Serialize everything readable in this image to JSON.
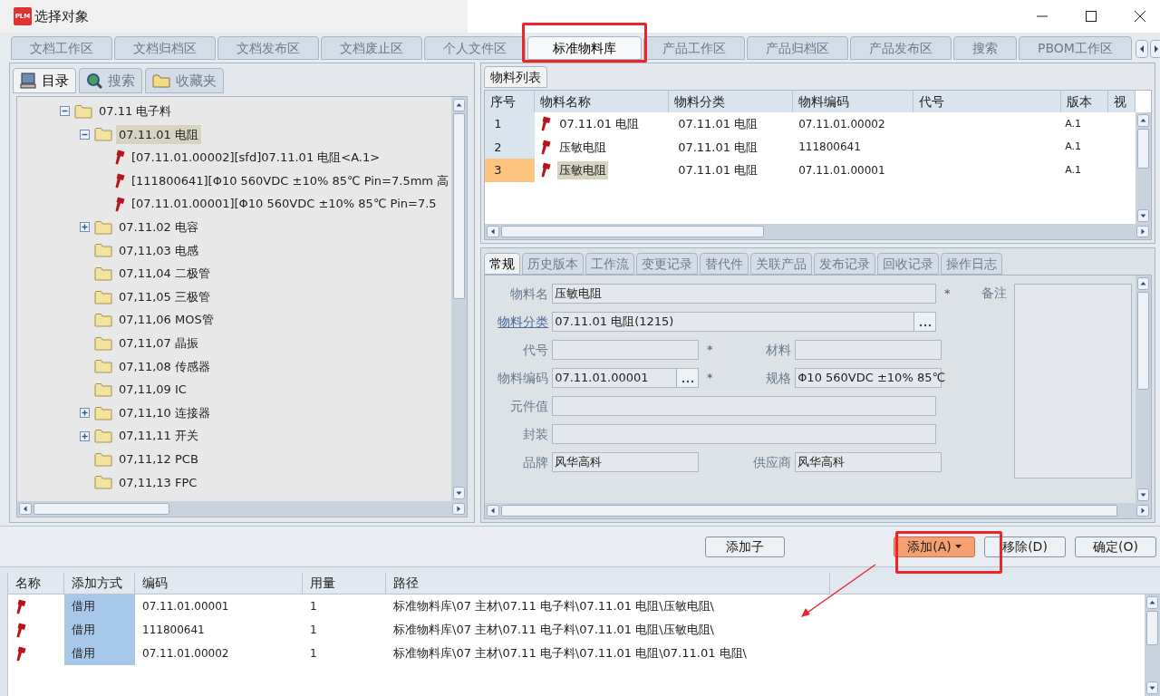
{
  "window": {
    "logo": "PLM",
    "title": "选择对象"
  },
  "tabs": [
    {
      "label": "文档工作区",
      "selected": false
    },
    {
      "label": "文档归档区",
      "selected": false
    },
    {
      "label": "文档发布区",
      "selected": false
    },
    {
      "label": "文档废止区",
      "selected": false
    },
    {
      "label": "个人文件区",
      "selected": false
    },
    {
      "label": "标准物料库",
      "selected": true
    },
    {
      "label": "产品工作区",
      "selected": false
    },
    {
      "label": "产品归档区",
      "selected": false
    },
    {
      "label": "产品发布区",
      "selected": false
    },
    {
      "label": "搜索",
      "selected": false
    },
    {
      "label": "PBOM工作区",
      "selected": false
    }
  ],
  "left_tabs": [
    {
      "label": "目录",
      "selected": true
    },
    {
      "label": "搜索",
      "selected": false
    },
    {
      "label": "收藏夹",
      "selected": false
    }
  ],
  "tree": [
    {
      "label": "07.11 电子料",
      "kind": "folder",
      "expanded": true,
      "selected": false,
      "children": [
        {
          "label": "07.11.01 电阻",
          "kind": "folder",
          "expanded": true,
          "selected": true,
          "children": [
            {
              "label": "[07.11.01.00002][sfd]07.11.01 电阻<A.1>",
              "kind": "part",
              "selected": false
            },
            {
              "label": "[111800641][Φ10 560VDC ±10% 85℃ Pin=7.5mm 高",
              "kind": "part",
              "selected": false
            },
            {
              "label": "[07.11.01.00001][Φ10 560VDC ±10% 85℃ Pin=7.5",
              "kind": "part",
              "selected": false
            }
          ]
        },
        {
          "label": "07.11.02 电容",
          "kind": "folder",
          "expanded": false,
          "selected": false
        },
        {
          "label": "07,11,03 电感",
          "kind": "folder",
          "selected": false
        },
        {
          "label": "07,11,04 二极管",
          "kind": "folder",
          "selected": false
        },
        {
          "label": "07,11,05 三极管",
          "kind": "folder",
          "selected": false
        },
        {
          "label": "07,11,06 MOS管",
          "kind": "folder",
          "selected": false
        },
        {
          "label": "07,11,07 晶振",
          "kind": "folder",
          "selected": false
        },
        {
          "label": "07,11,08 传感器",
          "kind": "folder",
          "selected": false
        },
        {
          "label": "07,11,09 IC",
          "kind": "folder",
          "selected": false
        },
        {
          "label": "07,11,10 连接器",
          "kind": "folder",
          "expanded": false,
          "selected": false
        },
        {
          "label": "07,11,11 开关",
          "kind": "folder",
          "expanded": false,
          "selected": false
        },
        {
          "label": "07,11,12 PCB",
          "kind": "folder",
          "selected": false
        },
        {
          "label": "07,11,13 FPC",
          "kind": "folder",
          "selected": false
        }
      ]
    }
  ],
  "list_tab": "物料列表",
  "material_table": {
    "columns": [
      "序号",
      "物料名称",
      "物料分类",
      "物料编码",
      "代号",
      "版本",
      "视"
    ],
    "rows": [
      {
        "no": "1",
        "name": "07.11.01 电阻",
        "category": "07.11.01 电阻",
        "code": "07.11.01.00002",
        "version": "A.1",
        "selected": false
      },
      {
        "no": "2",
        "name": "压敏电阻",
        "category": "07.11.01 电阻",
        "code": "111800641",
        "version": "A.1",
        "selected": false
      },
      {
        "no": "3",
        "name": "压敏电阻",
        "category": "07.11.01 电阻",
        "code": "07.11.01.00001",
        "version": "A.1",
        "selected": true
      }
    ]
  },
  "detail_tabs": [
    {
      "label": "常规",
      "selected": true
    },
    {
      "label": "历史版本",
      "selected": false
    },
    {
      "label": "工作流",
      "selected": false
    },
    {
      "label": "变更记录",
      "selected": false
    },
    {
      "label": "替代件",
      "selected": false
    },
    {
      "label": "关联产品",
      "selected": false
    },
    {
      "label": "发布记录",
      "selected": false
    },
    {
      "label": "回收记录",
      "selected": false
    },
    {
      "label": "操作日志",
      "selected": false
    }
  ],
  "form": {
    "rows": [
      [
        {
          "label": "物料名",
          "value": "压敏电阻",
          "mark": "*",
          "link": false,
          "picker": false
        }
      ],
      [
        {
          "label": "物料分类",
          "value": "07.11.01 电阻(1215)",
          "link": true,
          "picker": true
        }
      ],
      [
        {
          "label": "代号",
          "mark": "*",
          "link": false,
          "picker": false
        },
        {
          "label": "材料",
          "link": false,
          "picker": false
        }
      ],
      [
        {
          "label": "物料编码",
          "value": "07.11.01.00001",
          "mark": "*",
          "link": false,
          "picker": true
        },
        {
          "label": "规格",
          "value": "Φ10 560VDC ±10% 85℃",
          "link": false,
          "picker": false
        }
      ],
      [
        {
          "label": "元件值",
          "link": false,
          "picker": false
        }
      ],
      [
        {
          "label": "封装",
          "link": false,
          "picker": false
        }
      ],
      [
        {
          "label": "品牌",
          "value": "风华高科",
          "link": false,
          "picker": false
        },
        {
          "label": "供应商",
          "value": "风华高科",
          "link": false,
          "picker": false
        }
      ]
    ],
    "remark_label": "备注"
  },
  "buttons": [
    {
      "label": "添加子",
      "kind": "plain",
      "focused": false
    },
    {
      "label": "添加(A)",
      "kind": "split",
      "focused": true
    },
    {
      "label": "移除(D)",
      "kind": "plain",
      "focused": false
    },
    {
      "label": "确定(O)",
      "kind": "plain",
      "focused": false
    }
  ],
  "added_table": {
    "columns": [
      "名称",
      "添加方式",
      "编码",
      "用量",
      "路径"
    ],
    "rows": [
      {
        "method": "借用",
        "code": "07.11.01.00001",
        "qty": "1",
        "path": "标准物料库\\07 主材\\07.11 电子料\\07.11.01 电阻\\压敏电阻\\"
      },
      {
        "method": "借用",
        "code": "111800641",
        "qty": "1",
        "path": "标准物料库\\07 主材\\07.11 电子料\\07.11.01 电阻\\压敏电阻\\"
      },
      {
        "method": "借用",
        "code": "07.11.01.00002",
        "qty": "1",
        "path": "标准物料库\\07 主材\\07.11 电子料\\07.11.01 电阻\\07.11.01 电阻\\"
      }
    ]
  }
}
